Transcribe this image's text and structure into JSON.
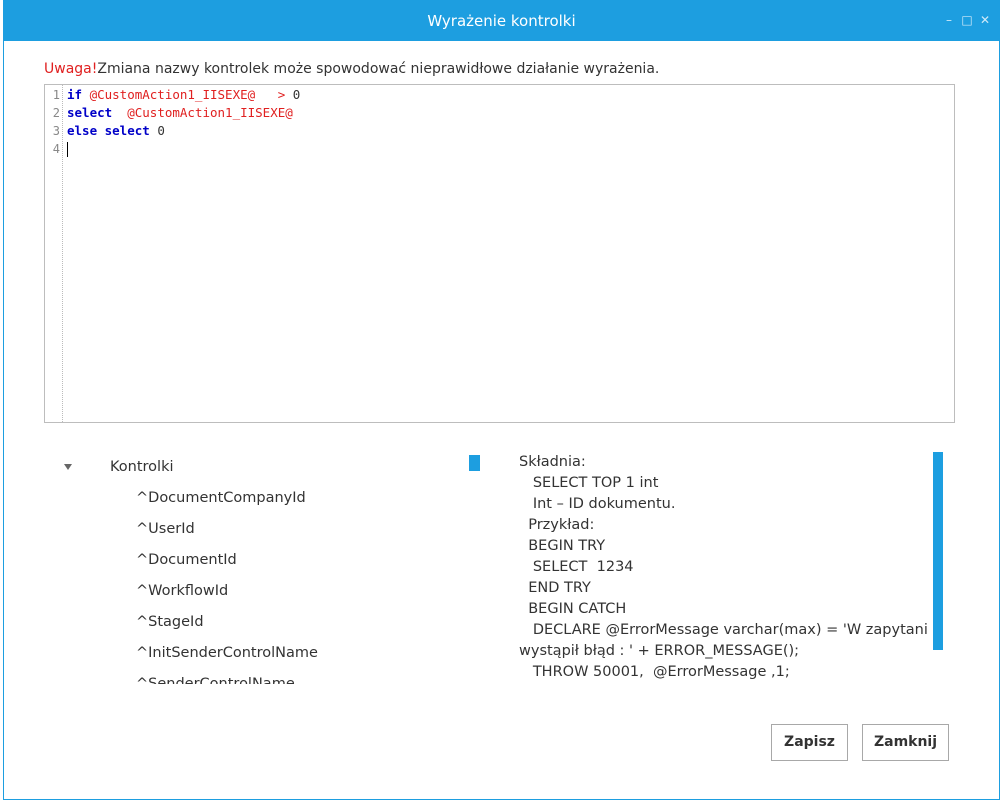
{
  "window": {
    "title": "Wyrażenie kontrolki"
  },
  "warning": {
    "label": "Uwaga!",
    "text": "Zmiana nazwy kontrolek może spowodować nieprawidłowe działanie wyrażenia."
  },
  "editor": {
    "lines": [
      {
        "n": "1",
        "parts": [
          {
            "t": "if ",
            "c": "kw"
          },
          {
            "t": "@CustomAction1_IISEXE@",
            "c": "var"
          },
          {
            "t": "   > ",
            "c": "var"
          },
          {
            "t": "0",
            "c": "num"
          }
        ]
      },
      {
        "n": "2",
        "parts": [
          {
            "t": "select ",
            "c": "kw"
          },
          {
            "t": " @CustomAction1_IISEXE@",
            "c": "var"
          }
        ]
      },
      {
        "n": "3",
        "parts": [
          {
            "t": "else select ",
            "c": "kw"
          },
          {
            "t": "0",
            "c": "num"
          }
        ]
      },
      {
        "n": "4",
        "parts": []
      }
    ]
  },
  "tree": {
    "root": "Kontrolki",
    "items": [
      "^DocumentCompanyId",
      "^UserId",
      "^DocumentId",
      "^WorkflowId",
      "^StageId",
      "^InitSenderControlName",
      "^SenderControlName"
    ]
  },
  "help": {
    "lines": [
      "Składnia:",
      "   SELECT TOP 1 int",
      "   Int – ID dokumentu.",
      "  Przykład:",
      "  BEGIN TRY",
      "   SELECT  1234",
      "  END TRY",
      "  BEGIN CATCH",
      "   DECLARE @ErrorMessage varchar(max) = 'W zapytaniu",
      "wystąpił błąd : ' + ERROR_MESSAGE();",
      "   THROW 50001,  @ErrorMessage ,1;"
    ]
  },
  "buttons": {
    "save": "Zapisz",
    "close": "Zamknij"
  }
}
